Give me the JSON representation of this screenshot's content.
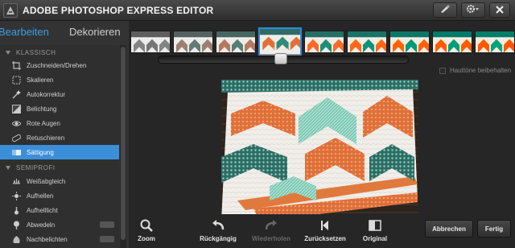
{
  "app": {
    "title": "ADOBE PHOTOSHOP EXPRESS EDITOR"
  },
  "tabs": [
    {
      "label": "Bearbeiten"
    },
    {
      "label": "Dekorieren"
    }
  ],
  "sidebar": {
    "sections": [
      {
        "label": "KLASSISCH"
      },
      {
        "label": "SEMIPROFI"
      }
    ],
    "items": [
      {
        "label": "Zuschneiden/Drehen",
        "icon": "crop-icon"
      },
      {
        "label": "Skalieren",
        "icon": "resize-icon"
      },
      {
        "label": "Autokorrektur",
        "icon": "magic-wand-icon"
      },
      {
        "label": "Belichtung",
        "icon": "exposure-icon"
      },
      {
        "label": "Rote Augen",
        "icon": "eye-icon"
      },
      {
        "label": "Retuschieren",
        "icon": "bandage-icon"
      },
      {
        "label": "Sättigung",
        "icon": "saturation-icon",
        "active": true
      },
      {
        "label": "Weißabgleich",
        "icon": "white-balance-icon"
      },
      {
        "label": "Aufhellen",
        "icon": "sun-icon"
      },
      {
        "label": "Aufhelllicht",
        "icon": "fill-light-icon"
      },
      {
        "label": "Abwedeln",
        "icon": "dodge-icon"
      },
      {
        "label": "Nachbelichten",
        "icon": "burn-icon"
      }
    ]
  },
  "strip": {
    "selected_label": "Original",
    "selected_index": 3,
    "count": 9
  },
  "slider": {
    "position": 0.5
  },
  "hauttone": {
    "label": "Hauttöne beibehalten",
    "checked": false
  },
  "toolbar": {
    "zoom": "Zoom",
    "undo": "Rückgängig",
    "redo": "Wiederholen",
    "reset": "Zurücksetzen",
    "original": "Original"
  },
  "buttons": {
    "cancel": "Abbrechen",
    "done": "Fertig"
  },
  "colors": {
    "accent": "#3b8fd9",
    "active_tab": "#3aa0e6"
  }
}
